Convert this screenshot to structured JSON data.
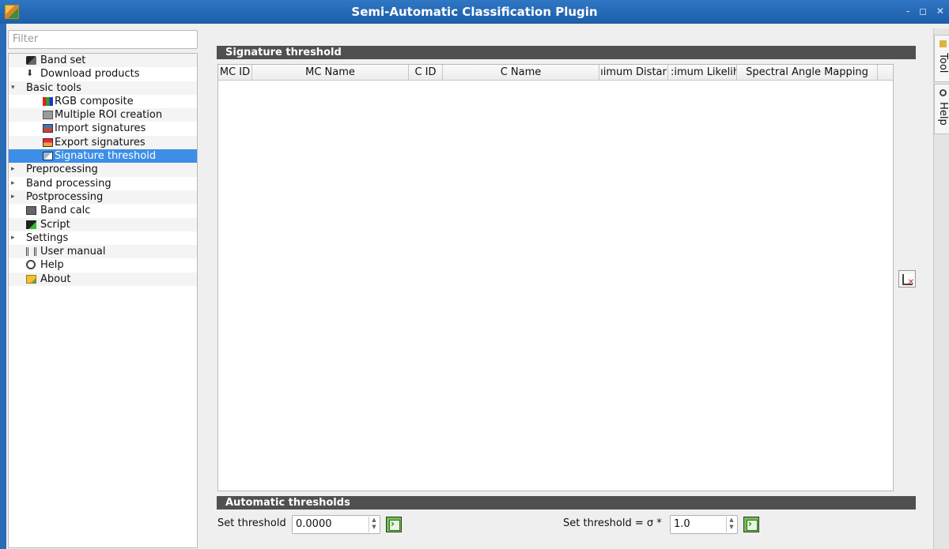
{
  "window": {
    "title": "Semi-Automatic Classification Plugin",
    "controls": "- ◻ ✕"
  },
  "sidebar": {
    "filter_placeholder": "Filter",
    "items": [
      {
        "label": "Band set",
        "level": 0,
        "icon": "band-set-icon"
      },
      {
        "label": "Download products",
        "level": 0,
        "icon": "download-icon"
      },
      {
        "label": "Basic tools",
        "level": 0,
        "expanded": true
      },
      {
        "label": "RGB composite",
        "level": 1,
        "icon": "rgb-composite-icon"
      },
      {
        "label": "Multiple ROI creation",
        "level": 1,
        "icon": "multiple-roi-icon"
      },
      {
        "label": "Import signatures",
        "level": 1,
        "icon": "import-signatures-icon"
      },
      {
        "label": "Export signatures",
        "level": 1,
        "icon": "export-signatures-icon"
      },
      {
        "label": "Signature threshold",
        "level": 1,
        "icon": "signature-threshold-icon",
        "selected": true
      },
      {
        "label": "Preprocessing",
        "level": 0,
        "collapsed": true
      },
      {
        "label": "Band processing",
        "level": 0,
        "collapsed": true
      },
      {
        "label": "Postprocessing",
        "level": 0,
        "collapsed": true
      },
      {
        "label": "Band calc",
        "level": 0,
        "icon": "band-calc-icon"
      },
      {
        "label": "Script",
        "level": 0,
        "icon": "script-icon"
      },
      {
        "label": "Settings",
        "level": 0,
        "collapsed": true
      },
      {
        "label": "User manual",
        "level": 0,
        "icon": "user-manual-icon"
      },
      {
        "label": "Help",
        "level": 0,
        "icon": "help-icon"
      },
      {
        "label": "About",
        "level": 0,
        "icon": "about-icon"
      }
    ]
  },
  "main": {
    "signature_section_title": "Signature threshold",
    "table": {
      "columns": [
        "MC ID",
        "MC Name",
        "C ID",
        "C Name",
        "ıimum Distar",
        ":imum Likelih",
        "Spectral Angle Mapping"
      ],
      "rows": []
    },
    "auto_section_title": "Automatic  thresholds",
    "set_threshold_label": "Set threshold",
    "set_threshold_value": "0.0000",
    "set_threshold_sigma_label": "Set threshold = σ *",
    "set_threshold_sigma_value": "1.0"
  },
  "dock_tabs": [
    "Tool",
    "Help"
  ],
  "colors": {
    "titlebar": "#1d5ea9",
    "selection": "#3d8ee6",
    "section_header": "#505050"
  }
}
